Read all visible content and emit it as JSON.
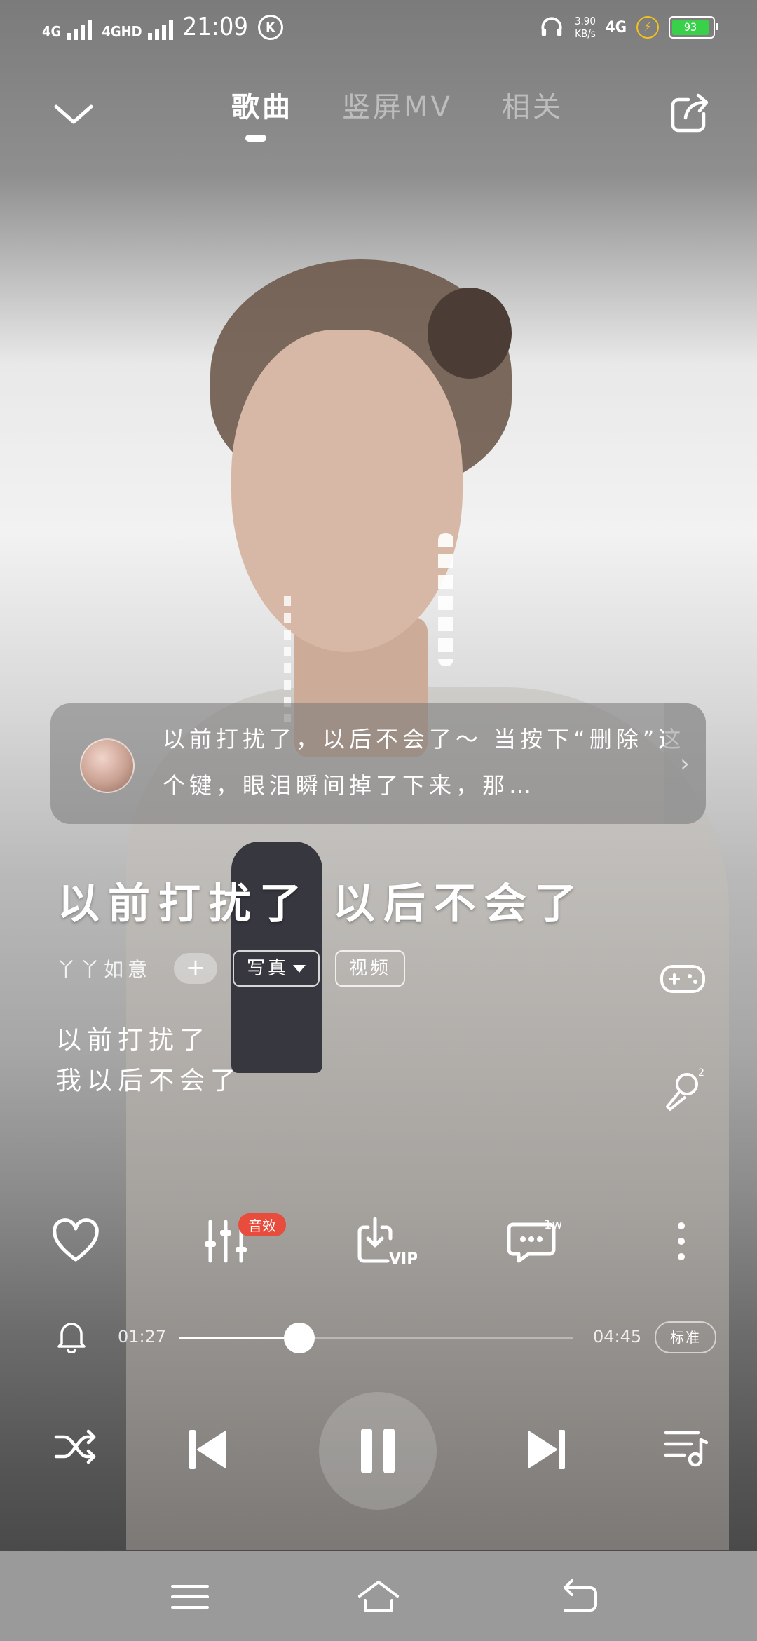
{
  "status_bar": {
    "sig1_label": "4G",
    "sig2_label": "4GHD",
    "time": "21:09",
    "k_icon": "K",
    "net_speed_value": "3.90",
    "net_speed_unit": "KB/s",
    "net_type": "4G",
    "battery": "93"
  },
  "tabs": [
    {
      "label": "歌曲"
    },
    {
      "label": "竖屏MV"
    },
    {
      "label": "相关"
    }
  ],
  "comment": {
    "text": "以前打扰了，以后不会了～ 当按下“删除”这个键，眼泪瞬间掉了下来，那…",
    "more": "›"
  },
  "song": {
    "title": "以前打扰了 以后不会了",
    "artist": "丫丫如意",
    "follow": "+",
    "chip_photo": "写真",
    "chip_video": "视频"
  },
  "lyrics": {
    "line1": "以前打扰了",
    "line2": "我以后不会了"
  },
  "actions": {
    "effects_badge": "音效",
    "comments_count": "1w"
  },
  "progress": {
    "current": "01:27",
    "total": "04:45",
    "fraction": 0.305,
    "quality": "标准"
  },
  "colors": {
    "badge": "#e74c3c",
    "battery_fill": "#3ad14a",
    "charging": "#f1c21b"
  }
}
